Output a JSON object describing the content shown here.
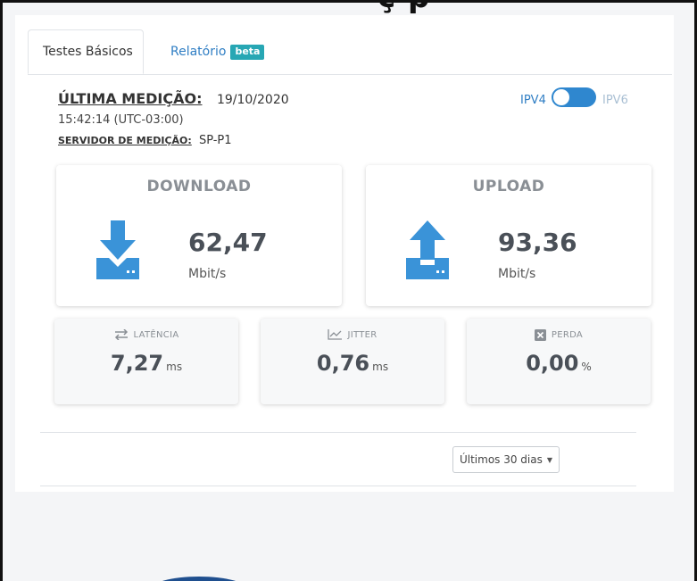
{
  "header_fragment": "ç      p",
  "tabs": [
    {
      "label": "Testes Básicos",
      "active": true
    },
    {
      "label": "Relatório",
      "badge": "beta",
      "active": false
    }
  ],
  "measurement": {
    "last_label": "ÚLTIMA MEDIÇÃO:",
    "date": "19/10/2020",
    "time": "15:42:14 (UTC-03:00)",
    "server_label": "SERVIDOR DE MEDIÇÃO:",
    "server": "SP-P1"
  },
  "ip_toggle": {
    "left": "IPV4",
    "right": "IPV6",
    "selected": "IPV4"
  },
  "download": {
    "title": "DOWNLOAD",
    "value": "62,47",
    "unit": "Mbit/s",
    "icon": "download-icon"
  },
  "upload": {
    "title": "UPLOAD",
    "value": "93,36",
    "unit": "Mbit/s",
    "icon": "upload-icon"
  },
  "metrics": [
    {
      "title": "LATÊNCIA",
      "value": "7,27",
      "unit": "ms",
      "icon": "arrows-swap-icon"
    },
    {
      "title": "JITTER",
      "value": "0,76",
      "unit": "ms",
      "icon": "line-chart-icon"
    },
    {
      "title": "PERDA",
      "value": "0,00",
      "unit": "%",
      "icon": "close-box-icon"
    }
  ],
  "period_select": {
    "value": "Últimos 30 dias"
  },
  "colors": {
    "accent": "#2f7ec4",
    "icon_blue": "#3a93d8",
    "badge": "#27a7b4",
    "value_text": "#4a5058",
    "muted_text": "#8a8f95"
  }
}
